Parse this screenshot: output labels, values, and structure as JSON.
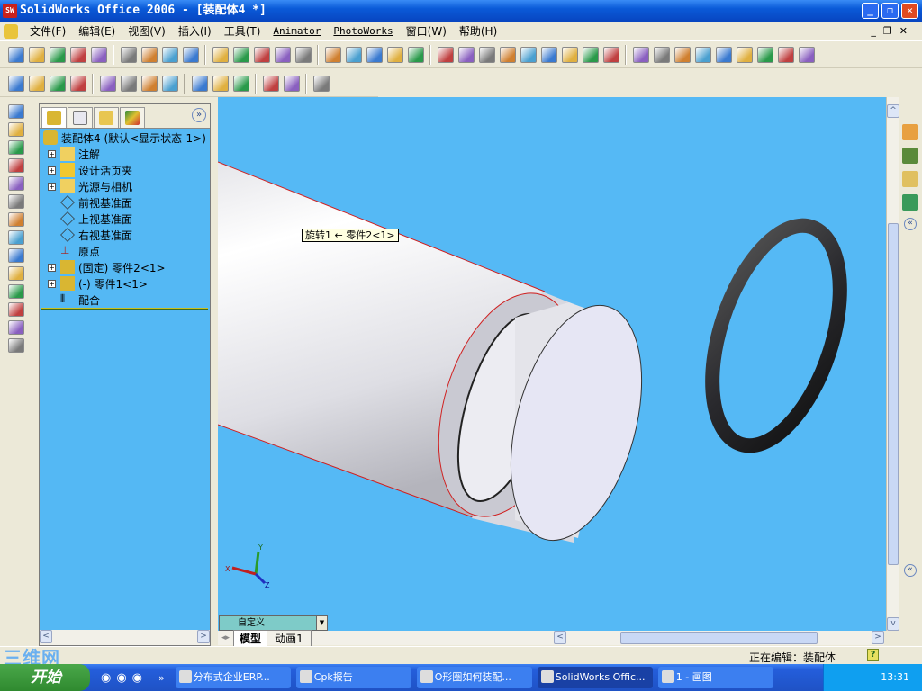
{
  "window": {
    "title": "SolidWorks Office 2006 - [装配体4 *]",
    "app_icon": "SW",
    "minimize": "_",
    "restore": "❐",
    "close": "✕"
  },
  "menu": {
    "items": [
      "文件(F)",
      "编辑(E)",
      "视图(V)",
      "插入(I)",
      "工具(T)",
      "Animator",
      "PhotoWorks",
      "窗口(W)",
      "帮助(H)"
    ]
  },
  "toolbar1": [
    "new",
    "open",
    "save",
    "print-preview",
    "options",
    "print",
    "zoom-to-page",
    "undo",
    "redo",
    "select",
    "select-filter",
    "sketch",
    "traffic-light",
    "grid",
    "bricks",
    "smart-mate",
    "move-component",
    "properties",
    "help",
    "measure",
    "zoom-fit",
    "zoom-area",
    "zoom-in-out",
    "zoom-selection",
    "rotate",
    "pan",
    "view-orientation",
    "display-style",
    "wireframe",
    "hidden-lines",
    "hidden-removed",
    "shaded-edges",
    "shaded",
    "shadows",
    "realview",
    "section",
    "perspective"
  ],
  "toolbar2": [
    "insert-component",
    "mate",
    "move-component",
    "rotate-component",
    "smart-fasteners",
    "explode",
    "explode-line",
    "interference",
    "feature",
    "hide-show",
    "edit-component",
    "assembly-features",
    "disabled1",
    "render"
  ],
  "lefttools": [
    "new-part",
    "existing-part",
    "hide",
    "show",
    "mate",
    "smart-fasteners",
    "move",
    "rotate",
    "explode",
    "explode-sketch",
    "interference-detection",
    "simulation",
    "toggle-1",
    "toggle-2"
  ],
  "featuremanager": {
    "tabs": [
      "feature-tree",
      "property-manager",
      "configuration-manager",
      "display-manager"
    ],
    "expand": "»",
    "root": "装配体4   (默认<显示状态-1>)",
    "items": [
      {
        "label": "注解",
        "expand": true,
        "icon": "annotation-icon"
      },
      {
        "label": "设计活页夹",
        "expand": true,
        "icon": "design-binder-icon"
      },
      {
        "label": "光源与相机",
        "expand": true,
        "icon": "lights-cameras-icon"
      },
      {
        "label": "前视基准面",
        "expand": false,
        "icon": "plane-icon"
      },
      {
        "label": "上视基准面",
        "expand": false,
        "icon": "plane-icon"
      },
      {
        "label": "右视基准面",
        "expand": false,
        "icon": "plane-icon"
      },
      {
        "label": "原点",
        "expand": false,
        "icon": "origin-icon"
      },
      {
        "label": "(固定) 零件2<1>",
        "expand": true,
        "icon": "part-icon"
      },
      {
        "label": "(-) 零件1<1>",
        "expand": true,
        "icon": "part-icon"
      },
      {
        "label": "配合",
        "expand": false,
        "icon": "mates-icon"
      }
    ]
  },
  "viewport": {
    "tooltip": "旋转1 ← 零件2<1>",
    "config_select": "自定义",
    "background": "#55b9f5",
    "triad": {
      "x": "X",
      "y": "Y",
      "z": "Z"
    }
  },
  "bottom_tabs": [
    "模型",
    "动画1"
  ],
  "status": {
    "editing": "正在编辑：装配体",
    "help": "?"
  },
  "watermark": "三维网",
  "taskbar": {
    "start": "开始",
    "tasks": [
      "分布式企业ERP...",
      "Cpk报告",
      "O形圈如何装配...",
      "SolidWorks Offic...",
      "1 - 画图"
    ],
    "active": 3,
    "clock": "13:31"
  }
}
